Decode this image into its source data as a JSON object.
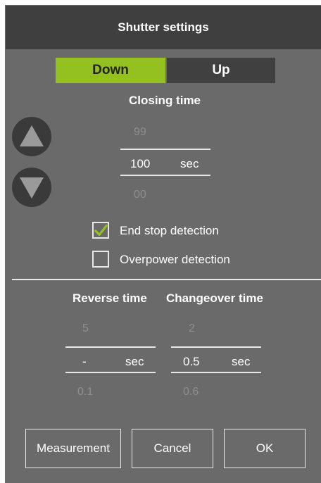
{
  "dialog": {
    "title": "Shutter settings"
  },
  "direction_tabs": {
    "down": "Down",
    "up": "Up",
    "selected": "Down"
  },
  "closing_time": {
    "label": "Closing time",
    "prev_value": "99",
    "value": "100",
    "unit": "sec",
    "next_value": "00"
  },
  "options": {
    "end_stop": {
      "label": "End stop detection",
      "checked": true
    },
    "overpower": {
      "label": "Overpower detection",
      "checked": false
    }
  },
  "reverse_time": {
    "label": "Reverse time",
    "prev_value": "5",
    "value": "-",
    "unit": "sec",
    "next_value": "0.1"
  },
  "changeover_time": {
    "label": "Changeover time",
    "prev_value": "2",
    "value": "0.5",
    "unit": "sec",
    "next_value": "0.6"
  },
  "buttons": {
    "measurement": "Measurement",
    "cancel": "Cancel",
    "ok": "OK"
  },
  "colors": {
    "accent": "#94c11f",
    "background": "#6a6a6a",
    "titlebar": "#3f3f3f"
  },
  "icons": [
    "arrow-up-icon",
    "arrow-down-icon",
    "checkmark-icon"
  ]
}
